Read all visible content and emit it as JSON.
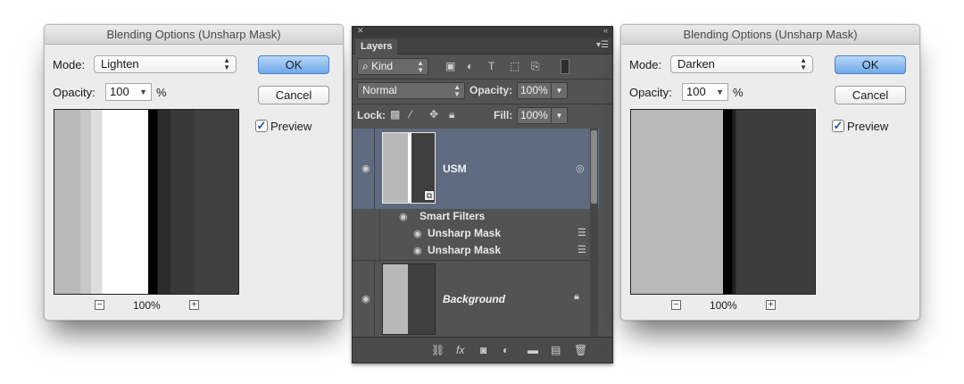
{
  "left_dialog": {
    "title": "Blending Options (Unsharp Mask)",
    "mode_label": "Mode:",
    "mode_value": "Lighten",
    "opacity_label": "Opacity:",
    "opacity_value": "100",
    "percent": "%",
    "ok": "OK",
    "cancel": "Cancel",
    "preview_label": "Preview",
    "preview_checked": true,
    "zoom": "100%"
  },
  "right_dialog": {
    "title": "Blending Options (Unsharp Mask)",
    "mode_label": "Mode:",
    "mode_value": "Darken",
    "opacity_label": "Opacity:",
    "opacity_value": "100",
    "percent": "%",
    "ok": "OK",
    "cancel": "Cancel",
    "preview_label": "Preview",
    "preview_checked": true,
    "zoom": "100%"
  },
  "layers_panel": {
    "tab": "Layers",
    "filter_kind": "Kind",
    "blend_mode": "Normal",
    "opacity_label": "Opacity:",
    "opacity_value": "100%",
    "lock_label": "Lock:",
    "fill_label": "Fill:",
    "fill_value": "100%",
    "layers": [
      {
        "name": "USM",
        "selected": true,
        "smart_object": true
      },
      {
        "name": "Background",
        "italic": true,
        "locked": true
      }
    ],
    "smart_filters": {
      "label": "Smart Filters",
      "filters": [
        "Unsharp Mask",
        "Unsharp Mask"
      ]
    }
  },
  "colors": {
    "selected_layer": "#5d6a7f",
    "panel_bg": "#535353",
    "ok_button": "#6fa8ea"
  }
}
